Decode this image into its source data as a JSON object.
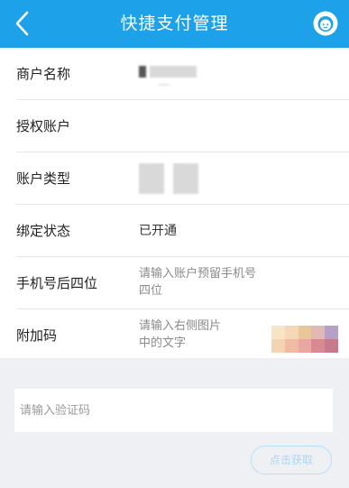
{
  "header": {
    "title": "快捷支付管理",
    "accent_color": "#1da1e8",
    "back_icon": "chevron-left-icon",
    "service_icon": "customer-service-icon"
  },
  "form": {
    "rows": [
      {
        "label": "商户名称",
        "value": ""
      },
      {
        "label": "授权账户",
        "value": ""
      },
      {
        "label": "账户类型",
        "value": ""
      },
      {
        "label": "绑定状态",
        "value": "已开通"
      },
      {
        "label": "手机号后四位",
        "placeholder_line1": "请输入账户预留手机号",
        "placeholder_line2": "四位"
      },
      {
        "label": "附加码",
        "placeholder_line1": "请输入右侧图片",
        "placeholder_line2": "中的文字"
      }
    ]
  },
  "verification": {
    "placeholder": "请输入验证码",
    "get_code_label": "点击获取"
  }
}
